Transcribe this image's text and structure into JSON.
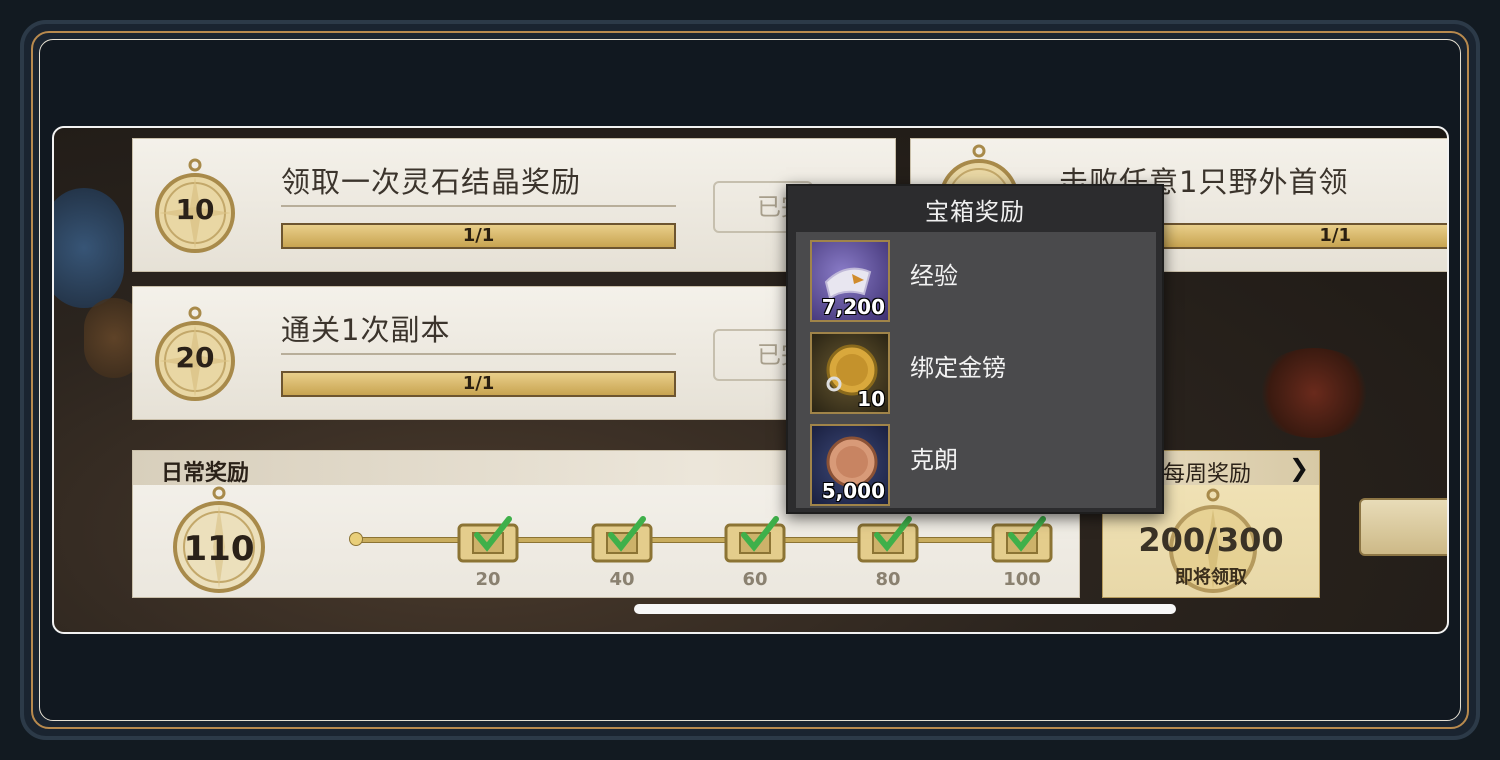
{
  "tasks": [
    {
      "points": "10",
      "title": "领取一次灵石结晶奖励",
      "progress": "1/1",
      "status": "已完"
    },
    {
      "points": "20",
      "title": "通关1次副本",
      "progress": "1/1",
      "status": "已完"
    },
    {
      "points": "",
      "title": "击败任意1只野外首领",
      "progress": "1/1",
      "status": ""
    }
  ],
  "daily": {
    "label": "日常奖励",
    "points": "110",
    "milestones": [
      "20",
      "40",
      "60",
      "80",
      "100"
    ]
  },
  "weekly": {
    "label": "每周奖励",
    "score": "200/300",
    "status": "即将领取"
  },
  "popup": {
    "title": "宝箱奖励",
    "rewards": [
      {
        "name": "经验",
        "count": "7,200",
        "icon": "exp-scroll-icon"
      },
      {
        "name": "绑定金镑",
        "count": "10",
        "icon": "bound-gold-coin-icon"
      },
      {
        "name": "克朗",
        "count": "5,000",
        "icon": "crown-coin-icon"
      }
    ]
  },
  "colors": {
    "gold_border": "#b88a4e",
    "panel": "#f4f1ea",
    "popup_bg": "#2c2c2e",
    "check": "#3fb04a"
  }
}
